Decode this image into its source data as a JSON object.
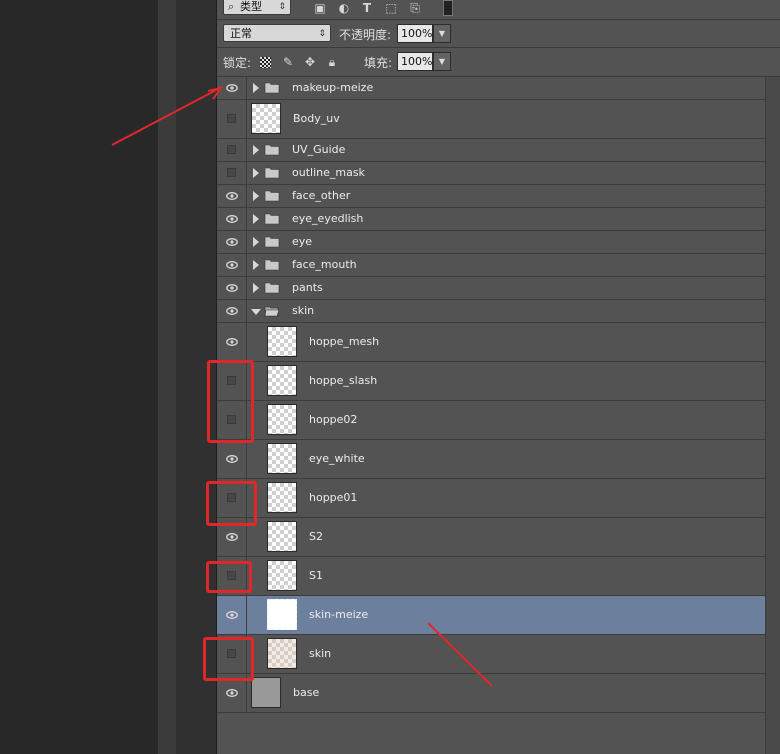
{
  "toolbar": {
    "filter_label": "类型",
    "blend_mode": "正常",
    "opacity_label": "不透明度:",
    "opacity_value": "100%",
    "lock_label": "锁定:",
    "fill_label": "填充:",
    "fill_value": "100%"
  },
  "layers": [
    {
      "name": "makeup-meize",
      "type": "group",
      "visible": true,
      "expanded": false
    },
    {
      "name": "Body_uv",
      "type": "layer",
      "visible": false
    },
    {
      "name": "UV_Guide",
      "type": "group",
      "visible": false,
      "expanded": false
    },
    {
      "name": "outline_mask",
      "type": "group",
      "visible": false,
      "expanded": false
    },
    {
      "name": "face_other",
      "type": "group",
      "visible": true,
      "expanded": false
    },
    {
      "name": "eye_eyedlish",
      "type": "group",
      "visible": true,
      "expanded": false
    },
    {
      "name": "eye",
      "type": "group",
      "visible": true,
      "expanded": false
    },
    {
      "name": "face_mouth",
      "type": "group",
      "visible": true,
      "expanded": false
    },
    {
      "name": "pants",
      "type": "group",
      "visible": true,
      "expanded": false
    },
    {
      "name": "skin",
      "type": "group",
      "visible": true,
      "expanded": true
    },
    {
      "name": "hoppe_mesh",
      "type": "layer",
      "visible": true,
      "indent": true
    },
    {
      "name": "hoppe_slash",
      "type": "layer",
      "visible": false,
      "indent": true
    },
    {
      "name": "hoppe02",
      "type": "layer",
      "visible": false,
      "indent": true
    },
    {
      "name": "eye_white",
      "type": "layer",
      "visible": true,
      "indent": true
    },
    {
      "name": "hoppe01",
      "type": "layer",
      "visible": false,
      "indent": true
    },
    {
      "name": "S2",
      "type": "layer",
      "visible": true,
      "indent": true
    },
    {
      "name": "S1",
      "type": "layer",
      "visible": false,
      "indent": true
    },
    {
      "name": "skin-meize",
      "type": "layer",
      "visible": true,
      "indent": true,
      "selected": true,
      "thumb": "white"
    },
    {
      "name": "skin",
      "type": "layer",
      "visible": false,
      "indent": true,
      "thumb": "peach"
    },
    {
      "name": "base",
      "type": "layer",
      "visible": true,
      "thumb": "gray"
    }
  ],
  "colors": {
    "panel": "#535353",
    "selected": "#6c7f9c",
    "annotation": "#e0282a"
  }
}
